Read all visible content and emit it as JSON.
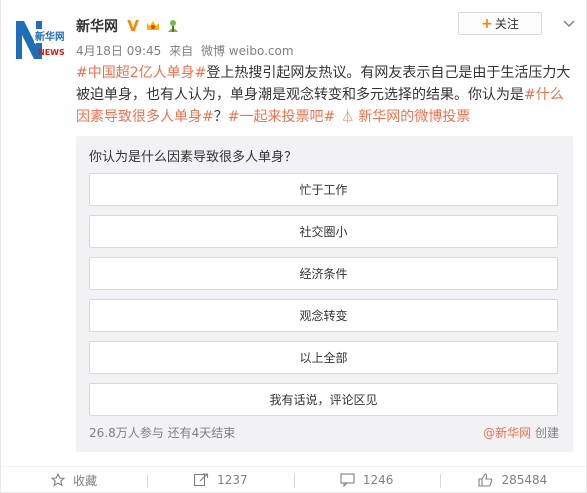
{
  "author": {
    "name": "新华网",
    "logo_text_cn": "新华网",
    "logo_text_en": "NEWS"
  },
  "meta": {
    "date": "4月18日 09:45",
    "source_prefix": "来自",
    "source": "微博 weibo.com"
  },
  "follow_button": {
    "label": "关注"
  },
  "post": {
    "hashtag_1": "#中国超2亿人单身#",
    "text_1": "登上热搜引起网友热议。有网友表示自己是由于生活压力大被迫单身，也有人认为，单身潮是观念转变和多元选择的结果。你认为是",
    "hashtag_2": "#什么因素导致很多人单身#",
    "text_2": "？",
    "hashtag_3": "#一起来投票吧#",
    "poll_link": "新华网的微博投票"
  },
  "poll": {
    "question": "你认为是什么因素导致很多人单身？",
    "options": [
      "忙于工作",
      "社交圈小",
      "经济条件",
      "观念转变",
      "以上全部",
      "我有话说，评论区见"
    ],
    "participants": "26.8万人参与",
    "remaining": "还有4天结束",
    "creator": "@新华网",
    "creator_suffix": "创建"
  },
  "actions": {
    "favorite": "收藏",
    "repost": "1237",
    "comment": "1246",
    "like": "285484"
  },
  "colors": {
    "link": "#eb7350",
    "accent": "#ff8200",
    "poll_bg": "#f2f2f5",
    "muted": "#808080"
  }
}
